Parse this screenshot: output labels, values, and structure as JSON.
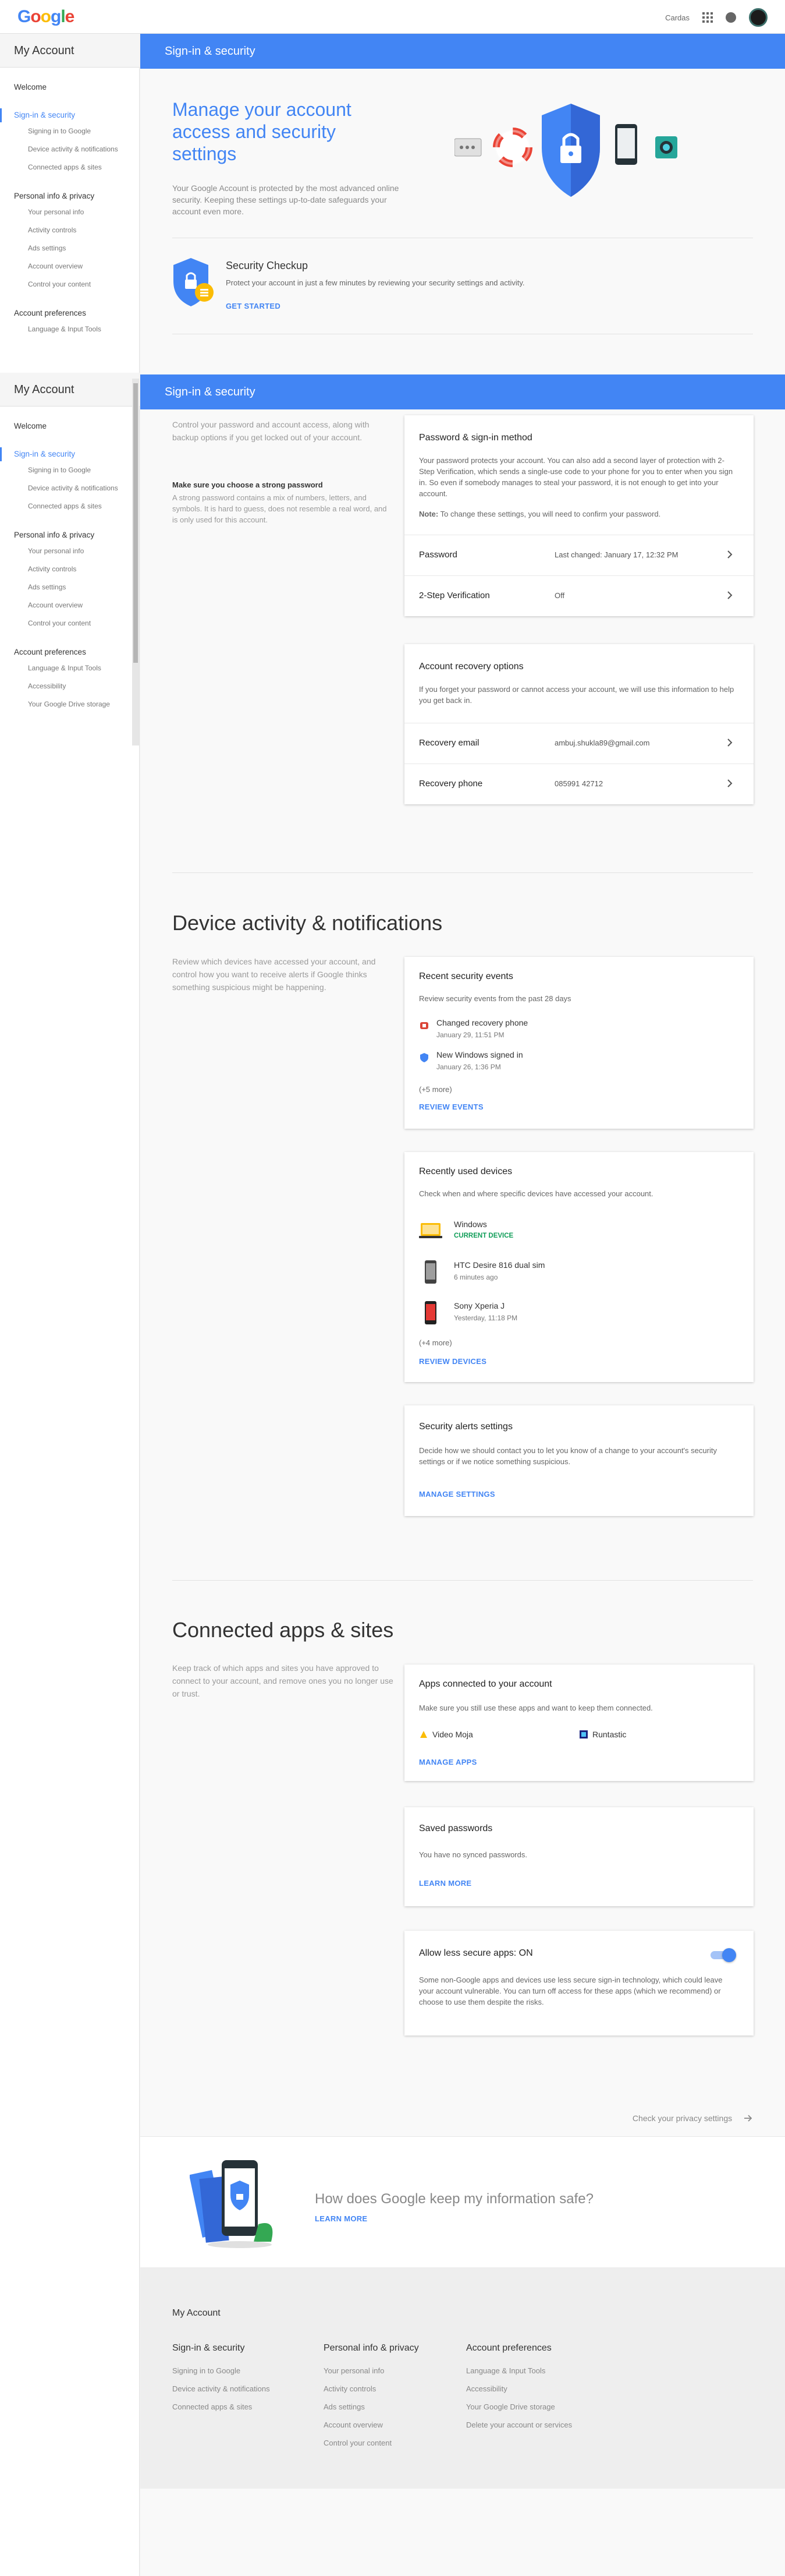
{
  "header": {
    "logo": "Google",
    "right_link": "Cardas"
  },
  "colors": {
    "accent": "#4285f4",
    "success": "#0f9d58",
    "logo": [
      "#4285f4",
      "#ea4335",
      "#fbbc05",
      "#4285f4",
      "#34a853",
      "#ea4335"
    ]
  },
  "sidebar1": {
    "title": "My Account",
    "welcome": "Welcome",
    "signin": "Sign-in & security",
    "signin_items": [
      "Signing in to Google",
      "Device activity & notifications",
      "Connected apps & sites"
    ],
    "personal": "Personal info & privacy",
    "personal_items": [
      "Your personal info",
      "Activity controls",
      "Ads settings",
      "Account overview",
      "Control your content"
    ],
    "prefs": "Account preferences",
    "prefs_items": [
      "Language & Input Tools"
    ]
  },
  "sidebar2": {
    "title": "My Account",
    "welcome": "Welcome",
    "signin": "Sign-in & security",
    "signin_items": [
      "Signing in to Google",
      "Device activity & notifications",
      "Connected apps & sites"
    ],
    "personal": "Personal info & privacy",
    "personal_items": [
      "Your personal info",
      "Activity controls",
      "Ads settings",
      "Account overview",
      "Control your content"
    ],
    "prefs": "Account preferences",
    "prefs_items": [
      "Language & Input Tools",
      "Accessibility",
      "Your Google Drive storage"
    ]
  },
  "band_title_1": "Sign-in & security",
  "band_title_2": "Sign-in & security",
  "hero": {
    "title": "Manage your account access and security settings",
    "desc": "Your Google Account is protected by the most advanced online security. Keeping these settings up-to-date safeguards your account even more."
  },
  "checkup": {
    "title": "Security Checkup",
    "desc": "Protect your account in just a few minutes by reviewing your security settings and activity.",
    "link": "GET STARTED"
  },
  "signin_section": {
    "intro": "Control your password and account access, along with backup options if you get locked out of your account.",
    "strong": "Make sure you choose a strong password",
    "strong_text": "A strong password contains a mix of numbers, letters, and symbols. It is hard to guess, does not resemble a real word, and is only used for this account."
  },
  "password_card": {
    "title": "Password & sign-in method",
    "text": "Your password protects your account. You can also add a second layer of protection with 2-Step Verification, which sends a single-use code to your phone for you to enter when you sign in. So even if somebody manages to steal your password, it is not enough to get into your account.",
    "note_label": "Note:",
    "note": " To change these settings, you will need to confirm your password.",
    "rows": [
      {
        "label": "Password",
        "value": "Last changed: January 17, 12:32 PM"
      },
      {
        "label": "2-Step Verification",
        "value": "Off"
      }
    ]
  },
  "recovery_card": {
    "title": "Account recovery options",
    "text": "If you forget your password or cannot access your account, we will use this information to help you get back in.",
    "rows": [
      {
        "label": "Recovery email",
        "value": "ambuj.shukla89@gmail.com"
      },
      {
        "label": "Recovery phone",
        "value": "085991 42712"
      }
    ]
  },
  "device_section": {
    "title": "Device activity & notifications",
    "intro": "Review which devices have accessed your account, and control how you want to receive alerts if Google thinks something suspicious might be happening."
  },
  "events_card": {
    "title": "Recent security events",
    "text": "Review security events from the past 28 days",
    "events": [
      {
        "title": "Changed recovery phone",
        "time": "January 29, 11:51 PM"
      },
      {
        "title": "New Windows signed in",
        "time": "January 26, 1:36 PM"
      }
    ],
    "more": "(+5 more)",
    "link": "REVIEW EVENTS"
  },
  "devices_card": {
    "title": "Recently used devices",
    "text": "Check when and where specific devices have accessed your account.",
    "devices": [
      {
        "name": "Windows",
        "status": "CURRENT DEVICE"
      },
      {
        "name": "HTC Desire 816 dual sim",
        "status": "6 minutes ago"
      },
      {
        "name": "Sony Xperia J",
        "status": "Yesterday, 11:18 PM"
      }
    ],
    "more": "(+4 more)",
    "link": "REVIEW DEVICES"
  },
  "alerts_card": {
    "title": "Security alerts settings",
    "text": "Decide how we should contact you to let you know of a change to your account's security settings or if we notice something suspicious.",
    "link": "MANAGE SETTINGS"
  },
  "apps_section": {
    "title": "Connected apps & sites",
    "intro": "Keep track of which apps and sites you have approved to connect to your account, and remove ones you no longer use or trust."
  },
  "apps_card": {
    "title": "Apps connected to your account",
    "text": "Make sure you still use these apps and want to keep them connected.",
    "apps": [
      "Video Moja",
      "Runtastic"
    ],
    "link": "MANAGE APPS"
  },
  "saved_card": {
    "title": "Saved passwords",
    "text": "You have no synced passwords.",
    "link": "LEARN MORE"
  },
  "less_secure_card": {
    "title": "Allow less secure apps: ON",
    "text": "Some non-Google apps and devices use less secure sign-in technology, which could leave your account vulnerable. You can turn off access for these apps (which we recommend) or choose to use them despite the risks."
  },
  "privacy_link": "Check your privacy settings",
  "safe": {
    "question": "How does Google keep my information safe?",
    "link": "LEARN MORE"
  },
  "footer": {
    "title": "My Account",
    "cols": [
      {
        "head": "Sign-in & security",
        "items": [
          "Signing in to Google",
          "Device activity & notifications",
          "Connected apps & sites"
        ]
      },
      {
        "head": "Personal info & privacy",
        "items": [
          "Your personal info",
          "Activity controls",
          "Ads settings",
          "Account overview",
          "Control your content"
        ]
      },
      {
        "head": "Account preferences",
        "items": [
          "Language & Input Tools",
          "Accessibility",
          "Your Google Drive storage",
          "Delete your account or services"
        ]
      }
    ]
  }
}
